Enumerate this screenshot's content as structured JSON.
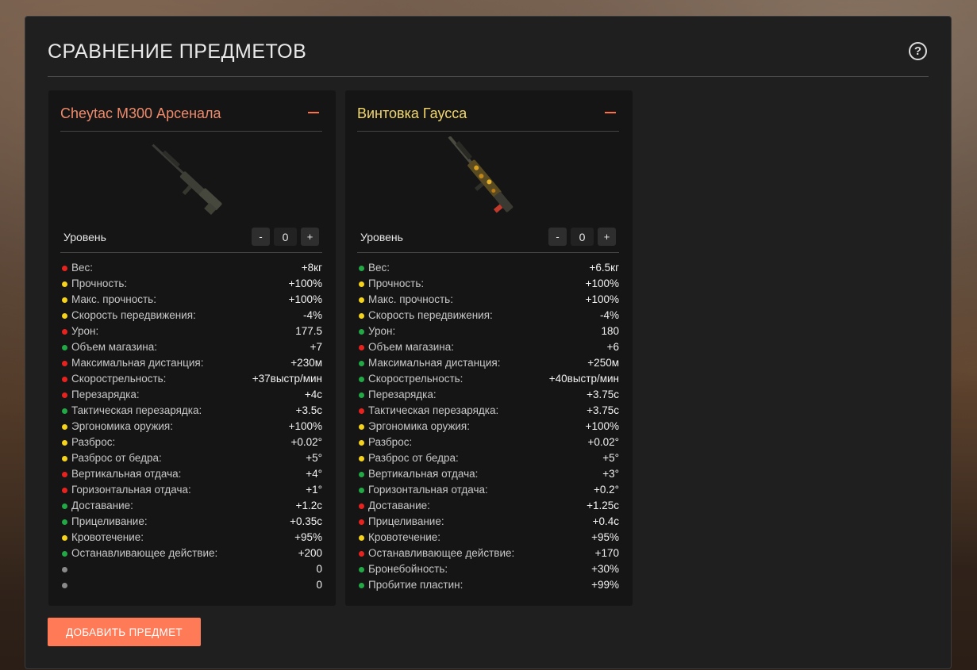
{
  "header": {
    "title": "СРАВНЕНИЕ ПРЕДМЕТОВ",
    "help_icon": "question-circle-icon"
  },
  "colors": {
    "good": "#22a845",
    "neutral": "#f5d21c",
    "bad": "#e8231f",
    "none": "#8a8a8a",
    "accent": "#ff7a56"
  },
  "items": [
    {
      "name": "Cheytac M300 Арсенала",
      "level_label": "Уровень",
      "level": "0",
      "minus": "-",
      "plus": "+",
      "stats": [
        {
          "label": "Вес:",
          "value": "+8кг",
          "status": "bad"
        },
        {
          "label": "Прочность:",
          "value": "+100%",
          "status": "neutral"
        },
        {
          "label": "Макс. прочность:",
          "value": "+100%",
          "status": "neutral"
        },
        {
          "label": "Скорость передвижения:",
          "value": "-4%",
          "status": "neutral"
        },
        {
          "label": "Урон:",
          "value": "177.5",
          "status": "bad"
        },
        {
          "label": "Объем магазина:",
          "value": "+7",
          "status": "good"
        },
        {
          "label": "Максимальная дистанция:",
          "value": "+230м",
          "status": "bad"
        },
        {
          "label": "Скорострельность:",
          "value": "+37выстр/мин",
          "status": "bad"
        },
        {
          "label": "Перезарядка:",
          "value": "+4с",
          "status": "bad"
        },
        {
          "label": "Тактическая перезарядка:",
          "value": "+3.5с",
          "status": "good"
        },
        {
          "label": "Эргономика оружия:",
          "value": "+100%",
          "status": "neutral"
        },
        {
          "label": "Разброс:",
          "value": "+0.02°",
          "status": "neutral"
        },
        {
          "label": "Разброс от бедра:",
          "value": "+5°",
          "status": "neutral"
        },
        {
          "label": "Вертикальная отдача:",
          "value": "+4°",
          "status": "bad"
        },
        {
          "label": "Горизонтальная отдача:",
          "value": "+1°",
          "status": "bad"
        },
        {
          "label": "Доставание:",
          "value": "+1.2с",
          "status": "good"
        },
        {
          "label": "Прицеливание:",
          "value": "+0.35с",
          "status": "good"
        },
        {
          "label": "Кровотечение:",
          "value": "+95%",
          "status": "neutral"
        },
        {
          "label": "Останавливающее действие:",
          "value": "+200",
          "status": "good"
        },
        {
          "label": "",
          "value": "0",
          "status": "none"
        },
        {
          "label": "",
          "value": "0",
          "status": "none"
        }
      ]
    },
    {
      "name": "Винтовка Гаусса",
      "level_label": "Уровень",
      "level": "0",
      "minus": "-",
      "plus": "+",
      "stats": [
        {
          "label": "Вес:",
          "value": "+6.5кг",
          "status": "good"
        },
        {
          "label": "Прочность:",
          "value": "+100%",
          "status": "neutral"
        },
        {
          "label": "Макс. прочность:",
          "value": "+100%",
          "status": "neutral"
        },
        {
          "label": "Скорость передвижения:",
          "value": "-4%",
          "status": "neutral"
        },
        {
          "label": "Урон:",
          "value": "180",
          "status": "good"
        },
        {
          "label": "Объем магазина:",
          "value": "+6",
          "status": "bad"
        },
        {
          "label": "Максимальная дистанция:",
          "value": "+250м",
          "status": "good"
        },
        {
          "label": "Скорострельность:",
          "value": "+40выстр/мин",
          "status": "good"
        },
        {
          "label": "Перезарядка:",
          "value": "+3.75с",
          "status": "good"
        },
        {
          "label": "Тактическая перезарядка:",
          "value": "+3.75с",
          "status": "bad"
        },
        {
          "label": "Эргономика оружия:",
          "value": "+100%",
          "status": "neutral"
        },
        {
          "label": "Разброс:",
          "value": "+0.02°",
          "status": "neutral"
        },
        {
          "label": "Разброс от бедра:",
          "value": "+5°",
          "status": "neutral"
        },
        {
          "label": "Вертикальная отдача:",
          "value": "+3°",
          "status": "good"
        },
        {
          "label": "Горизонтальная отдача:",
          "value": "+0.2°",
          "status": "good"
        },
        {
          "label": "Доставание:",
          "value": "+1.25с",
          "status": "bad"
        },
        {
          "label": "Прицеливание:",
          "value": "+0.4с",
          "status": "bad"
        },
        {
          "label": "Кровотечение:",
          "value": "+95%",
          "status": "neutral"
        },
        {
          "label": "Останавливающее действие:",
          "value": "+170",
          "status": "bad"
        },
        {
          "label": "Бронебойность:",
          "value": "+30%",
          "status": "good"
        },
        {
          "label": "Пробитие пластин:",
          "value": "+99%",
          "status": "good"
        }
      ]
    }
  ],
  "add_button": {
    "label": "ДОБАВИТЬ ПРЕДМЕТ"
  }
}
